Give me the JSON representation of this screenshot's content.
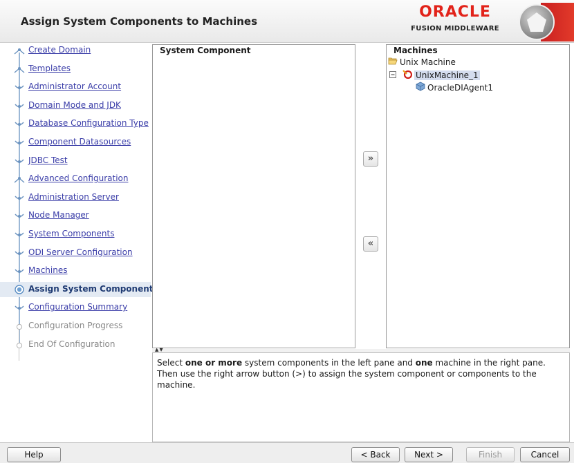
{
  "header": {
    "title": "Assign System Components to Machines",
    "brand_oracle": "ORACLE",
    "brand_fusion": "FUSION MIDDLEWARE",
    "brand_color": "#e2231a"
  },
  "nav": {
    "items": [
      {
        "label": "Create Domain",
        "state": "done"
      },
      {
        "label": "Templates",
        "state": "done"
      },
      {
        "label": "Administrator Account",
        "state": "done"
      },
      {
        "label": "Domain Mode and JDK",
        "state": "done"
      },
      {
        "label": "Database Configuration Type",
        "state": "done"
      },
      {
        "label": "Component Datasources",
        "state": "done"
      },
      {
        "label": "JDBC Test",
        "state": "done"
      },
      {
        "label": "Advanced Configuration",
        "state": "done"
      },
      {
        "label": "Administration Server",
        "state": "done"
      },
      {
        "label": "Node Manager",
        "state": "done"
      },
      {
        "label": "System Components",
        "state": "done"
      },
      {
        "label": "ODI Server Configuration",
        "state": "done"
      },
      {
        "label": "Machines",
        "state": "done"
      },
      {
        "label": "Assign System Component",
        "state": "current"
      },
      {
        "label": "Configuration Summary",
        "state": "next"
      },
      {
        "label": "Configuration Progress",
        "state": "disabled"
      },
      {
        "label": "End Of Configuration",
        "state": "disabled"
      }
    ]
  },
  "left_panel": {
    "header": "System Component"
  },
  "right_panel": {
    "header": "Machines",
    "tree": {
      "root": "Unix Machine",
      "machine": "UnixMachine_1",
      "component": "OracleDIAgent1"
    }
  },
  "buttons": {
    "assign_right": "»",
    "assign_left": "«",
    "help": "Help",
    "back": "< Back",
    "next": "Next >",
    "finish": "Finish",
    "cancel": "Cancel"
  },
  "description": {
    "p1": "Select ",
    "b1": "one or more",
    "p2": " system components in the left pane and ",
    "b2": "one",
    "p3": " machine in the right pane. Then use the right arrow button (>) to assign the system component or components to the machine."
  }
}
